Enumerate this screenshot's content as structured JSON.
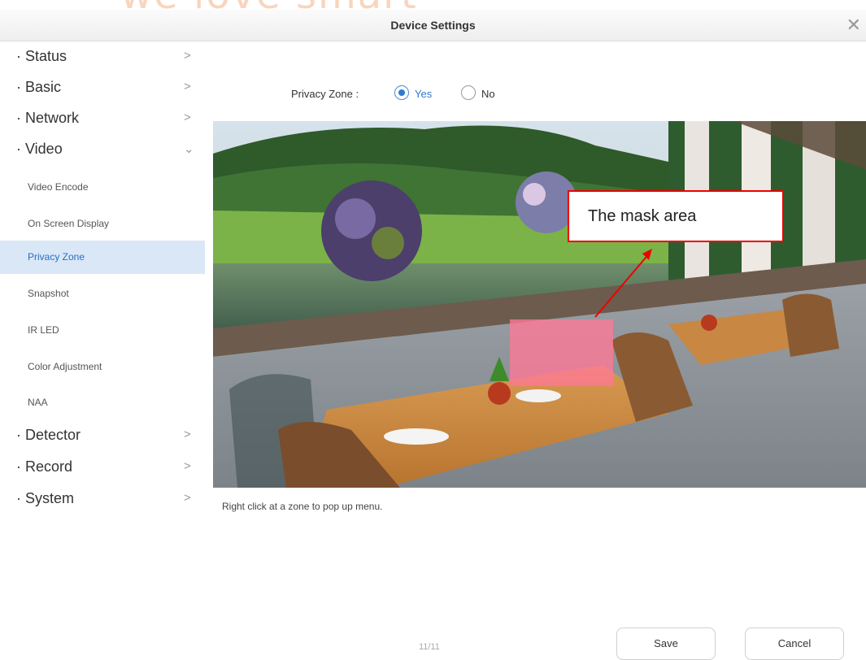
{
  "watermark": "we love smart",
  "dialog": {
    "title": "Device Settings",
    "close_glyph": "✕"
  },
  "sidebar": {
    "items": [
      {
        "label": "· Status",
        "arrow": ">"
      },
      {
        "label": "· Basic",
        "arrow": ">"
      },
      {
        "label": "· Network",
        "arrow": ">"
      },
      {
        "label": "· Video",
        "arrow": "⌄"
      },
      {
        "label": "· Detector",
        "arrow": ">"
      },
      {
        "label": "· Record",
        "arrow": ">"
      },
      {
        "label": "· System",
        "arrow": ">"
      }
    ],
    "video_subitems": [
      {
        "label": "Video Encode"
      },
      {
        "label": "On Screen Display"
      },
      {
        "label": "Privacy Zone",
        "active": true
      },
      {
        "label": "Snapshot"
      },
      {
        "label": "IR LED"
      },
      {
        "label": "Color Adjustment"
      },
      {
        "label": "NAA"
      }
    ]
  },
  "privacy_zone": {
    "label": "Privacy Zone :",
    "options": [
      {
        "label": "Yes",
        "selected": true
      },
      {
        "label": "No",
        "selected": false
      }
    ]
  },
  "annotation": {
    "text": "The mask area"
  },
  "hint": "Right click at a zone to pop up menu.",
  "pager": "11/11",
  "buttons": {
    "save": "Save",
    "cancel": "Cancel"
  },
  "colors": {
    "accent": "#2f79d3",
    "active_bg": "#d9e7f7",
    "mask": "#ff7896",
    "callout_border": "#e00000"
  }
}
